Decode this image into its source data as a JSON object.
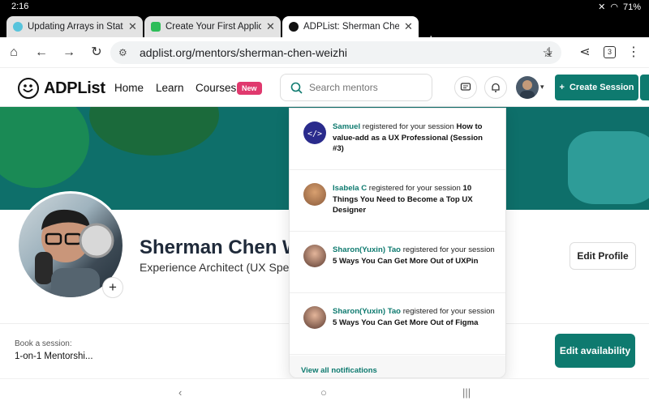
{
  "status": {
    "time": "2:16",
    "battery": "71%"
  },
  "tabs": [
    {
      "title": "Updating Arrays in State",
      "favicon": "react-icon",
      "color": "#58c4dc"
    },
    {
      "title": "Create Your First Applica",
      "favicon": "tab-app-icon",
      "color": "#2ebd59"
    },
    {
      "title": "ADPList: Sherman Chen",
      "favicon": "adplist-icon",
      "color": "#111111",
      "active": true
    }
  ],
  "browser": {
    "url": "adplist.org/mentors/sherman-chen-weizhi",
    "tab_count": "3"
  },
  "site": {
    "logo": "ADPList",
    "nav": {
      "home": "Home",
      "learn": "Learn",
      "courses": "Courses",
      "new_badge": "New"
    },
    "search_placeholder": "Search mentors",
    "create_session": "Create Session"
  },
  "profile": {
    "name": "Sherman Chen W",
    "title": "Experience Architect (UX Spec",
    "edit_profile": "Edit Profile"
  },
  "booking": {
    "label": "Book a session:",
    "value": "1-on-1 Mentorshi...",
    "edit_availability": "Edit availability"
  },
  "notifications": {
    "items": [
      {
        "who": "Samuel",
        "action": " registered for your session ",
        "session": "How to value-add as a UX Professional (Session #3)"
      },
      {
        "who": "Isabela C",
        "action": " registered for your session ",
        "session": "10 Things You Need to Become a Top UX Designer"
      },
      {
        "who": "Sharon(Yuxin) Tao",
        "action": " registered for your session ",
        "session": "5 Ways You Can Get More Out of UXPin"
      },
      {
        "who": "Sharon(Yuxin) Tao",
        "action": " registered for your session ",
        "session": "5 Ways You Can Get More Out of Figma"
      }
    ],
    "view_all": "View all notifications"
  },
  "colors": {
    "brand": "#0e7a6f",
    "banner": "#0e6f6a",
    "badge": "#e0396e"
  }
}
